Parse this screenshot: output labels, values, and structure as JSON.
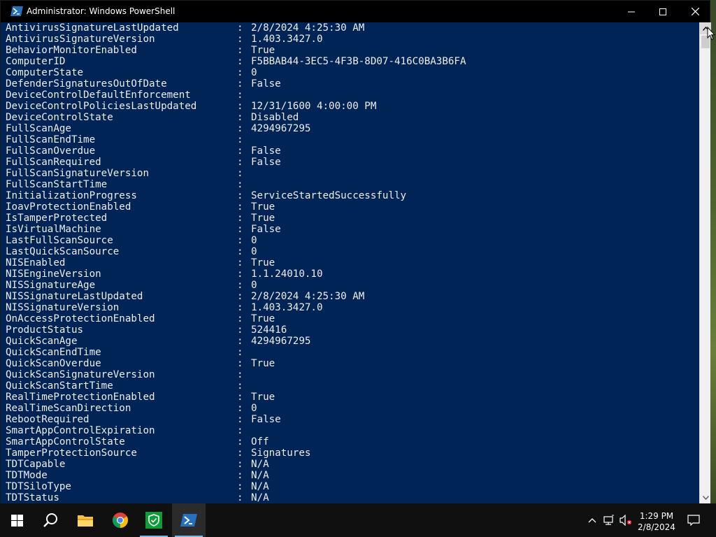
{
  "window": {
    "title": "Administrator: Windows PowerShell",
    "colors": {
      "console_bg": "#012456",
      "console_fg": "#eeedf0",
      "titlebar_bg": "#000000"
    }
  },
  "console": {
    "lines": [
      {
        "key": "AntivirusSignatureLastUpdated",
        "sep": ":",
        "value": "2/8/2024 4:25:30 AM"
      },
      {
        "key": "AntivirusSignatureVersion",
        "sep": ":",
        "value": "1.403.3427.0"
      },
      {
        "key": "BehaviorMonitorEnabled",
        "sep": ":",
        "value": "True"
      },
      {
        "key": "ComputerID",
        "sep": ":",
        "value": "F5BBAB44-3EC5-4F3B-8D07-416C0BA3B6FA"
      },
      {
        "key": "ComputerState",
        "sep": ":",
        "value": "0"
      },
      {
        "key": "DefenderSignaturesOutOfDate",
        "sep": ":",
        "value": "False"
      },
      {
        "key": "DeviceControlDefaultEnforcement",
        "sep": ":",
        "value": ""
      },
      {
        "key": "DeviceControlPoliciesLastUpdated",
        "sep": ":",
        "value": "12/31/1600 4:00:00 PM"
      },
      {
        "key": "DeviceControlState",
        "sep": ":",
        "value": "Disabled"
      },
      {
        "key": "FullScanAge",
        "sep": ":",
        "value": "4294967295"
      },
      {
        "key": "FullScanEndTime",
        "sep": ":",
        "value": ""
      },
      {
        "key": "FullScanOverdue",
        "sep": ":",
        "value": "False"
      },
      {
        "key": "FullScanRequired",
        "sep": ":",
        "value": "False"
      },
      {
        "key": "FullScanSignatureVersion",
        "sep": ":",
        "value": ""
      },
      {
        "key": "FullScanStartTime",
        "sep": ":",
        "value": ""
      },
      {
        "key": "InitializationProgress",
        "sep": ":",
        "value": "ServiceStartedSuccessfully"
      },
      {
        "key": "IoavProtectionEnabled",
        "sep": ":",
        "value": "True"
      },
      {
        "key": "IsTamperProtected",
        "sep": ":",
        "value": "True"
      },
      {
        "key": "IsVirtualMachine",
        "sep": ":",
        "value": "False"
      },
      {
        "key": "LastFullScanSource",
        "sep": ":",
        "value": "0"
      },
      {
        "key": "LastQuickScanSource",
        "sep": ":",
        "value": "0"
      },
      {
        "key": "NISEnabled",
        "sep": ":",
        "value": "True"
      },
      {
        "key": "NISEngineVersion",
        "sep": ":",
        "value": "1.1.24010.10"
      },
      {
        "key": "NISSignatureAge",
        "sep": ":",
        "value": "0"
      },
      {
        "key": "NISSignatureLastUpdated",
        "sep": ":",
        "value": "2/8/2024 4:25:30 AM"
      },
      {
        "key": "NISSignatureVersion",
        "sep": ":",
        "value": "1.403.3427.0"
      },
      {
        "key": "OnAccessProtectionEnabled",
        "sep": ":",
        "value": "True"
      },
      {
        "key": "ProductStatus",
        "sep": ":",
        "value": "524416"
      },
      {
        "key": "QuickScanAge",
        "sep": ":",
        "value": "4294967295"
      },
      {
        "key": "QuickScanEndTime",
        "sep": ":",
        "value": ""
      },
      {
        "key": "QuickScanOverdue",
        "sep": ":",
        "value": "True"
      },
      {
        "key": "QuickScanSignatureVersion",
        "sep": ":",
        "value": ""
      },
      {
        "key": "QuickScanStartTime",
        "sep": ":",
        "value": ""
      },
      {
        "key": "RealTimeProtectionEnabled",
        "sep": ":",
        "value": "True"
      },
      {
        "key": "RealTimeScanDirection",
        "sep": ":",
        "value": "0"
      },
      {
        "key": "RebootRequired",
        "sep": ":",
        "value": "False"
      },
      {
        "key": "SmartAppControlExpiration",
        "sep": ":",
        "value": ""
      },
      {
        "key": "SmartAppControlState",
        "sep": ":",
        "value": "Off"
      },
      {
        "key": "TamperProtectionSource",
        "sep": ":",
        "value": "Signatures"
      },
      {
        "key": "TDTCapable",
        "sep": ":",
        "value": "N/A"
      },
      {
        "key": "TDTMode",
        "sep": ":",
        "value": "N/A"
      },
      {
        "key": "TDTSiloType",
        "sep": ":",
        "value": "N/A"
      },
      {
        "key": "TDTStatus",
        "sep": ":",
        "value": "N/A"
      }
    ]
  },
  "taskbar": {
    "items": [
      {
        "name": "start-button",
        "icon": "windows-logo-icon"
      },
      {
        "name": "search-button",
        "icon": "search-icon"
      },
      {
        "name": "file-explorer",
        "icon": "folder-icon"
      },
      {
        "name": "chrome",
        "icon": "chrome-icon"
      },
      {
        "name": "windows-security",
        "icon": "shield-check-icon"
      },
      {
        "name": "powershell",
        "icon": "powershell-icon",
        "active": true
      }
    ],
    "tray": {
      "icons": [
        "chevron-up-icon",
        "network-icon",
        "volume-muted-icon"
      ],
      "time": "1:29 PM",
      "date": "2/8/2024",
      "notification_icon": "notification-icon"
    }
  }
}
